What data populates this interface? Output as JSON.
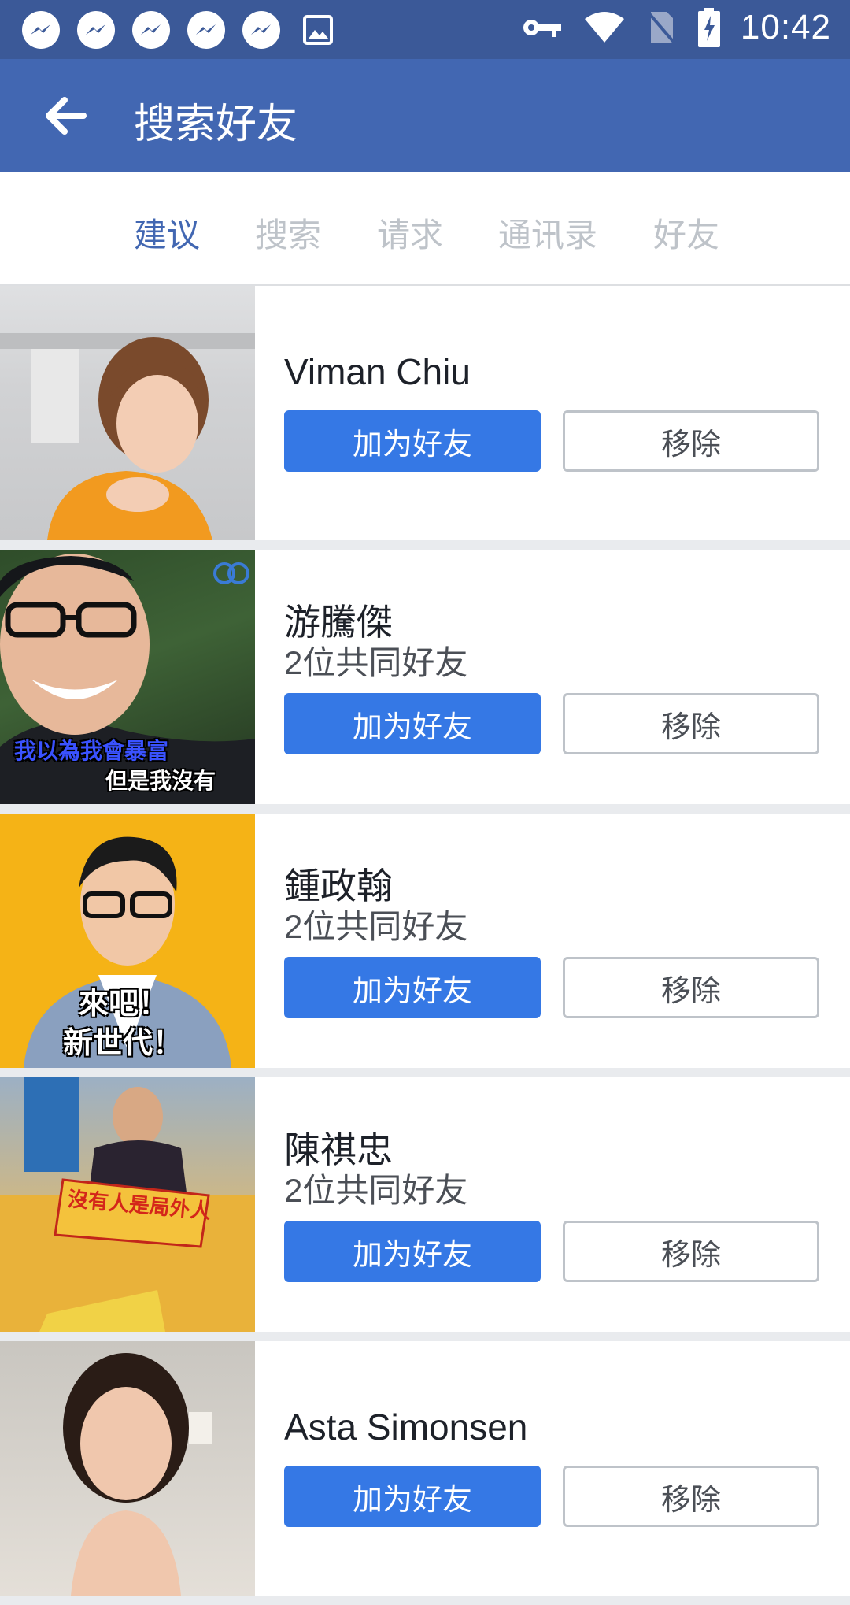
{
  "status_bar": {
    "time": "10:42",
    "left_icons": [
      "messenger-icon",
      "messenger-icon",
      "messenger-icon",
      "messenger-icon",
      "messenger-icon",
      "image-icon"
    ],
    "right_icons": [
      "vpn-key-icon",
      "wifi-icon",
      "no-sim-icon",
      "battery-charging-icon"
    ]
  },
  "app_bar": {
    "title": "搜索好友"
  },
  "tabs": [
    {
      "label": "建议",
      "active": true
    },
    {
      "label": "搜索",
      "active": false
    },
    {
      "label": "请求",
      "active": false
    },
    {
      "label": "通讯录",
      "active": false
    },
    {
      "label": "好友",
      "active": false
    }
  ],
  "suggestions": [
    {
      "name": "Viman Chiu",
      "mutual": "",
      "add_label": "加为好友",
      "remove_label": "移除"
    },
    {
      "name": "游騰傑",
      "mutual": "2位共同好友",
      "add_label": "加为好友",
      "remove_label": "移除",
      "photo_caption_1": "我以為我會暴富",
      "photo_caption_2": "但是我沒有"
    },
    {
      "name": "鍾政翰",
      "mutual": "2位共同好友",
      "add_label": "加为好友",
      "remove_label": "移除",
      "photo_caption_1": "來吧！",
      "photo_caption_2": "新世代！"
    },
    {
      "name": "陳祺忠",
      "mutual": "2位共同好友",
      "add_label": "加为好友",
      "remove_label": "移除",
      "photo_caption_1": "沒有人是局外人"
    },
    {
      "name": "Asta Simonsen",
      "mutual": "",
      "add_label": "加为好友",
      "remove_label": "移除"
    }
  ],
  "colors": {
    "header": "#4267b2",
    "status_bar": "#3b5998",
    "button_blue": "#3578e5"
  }
}
